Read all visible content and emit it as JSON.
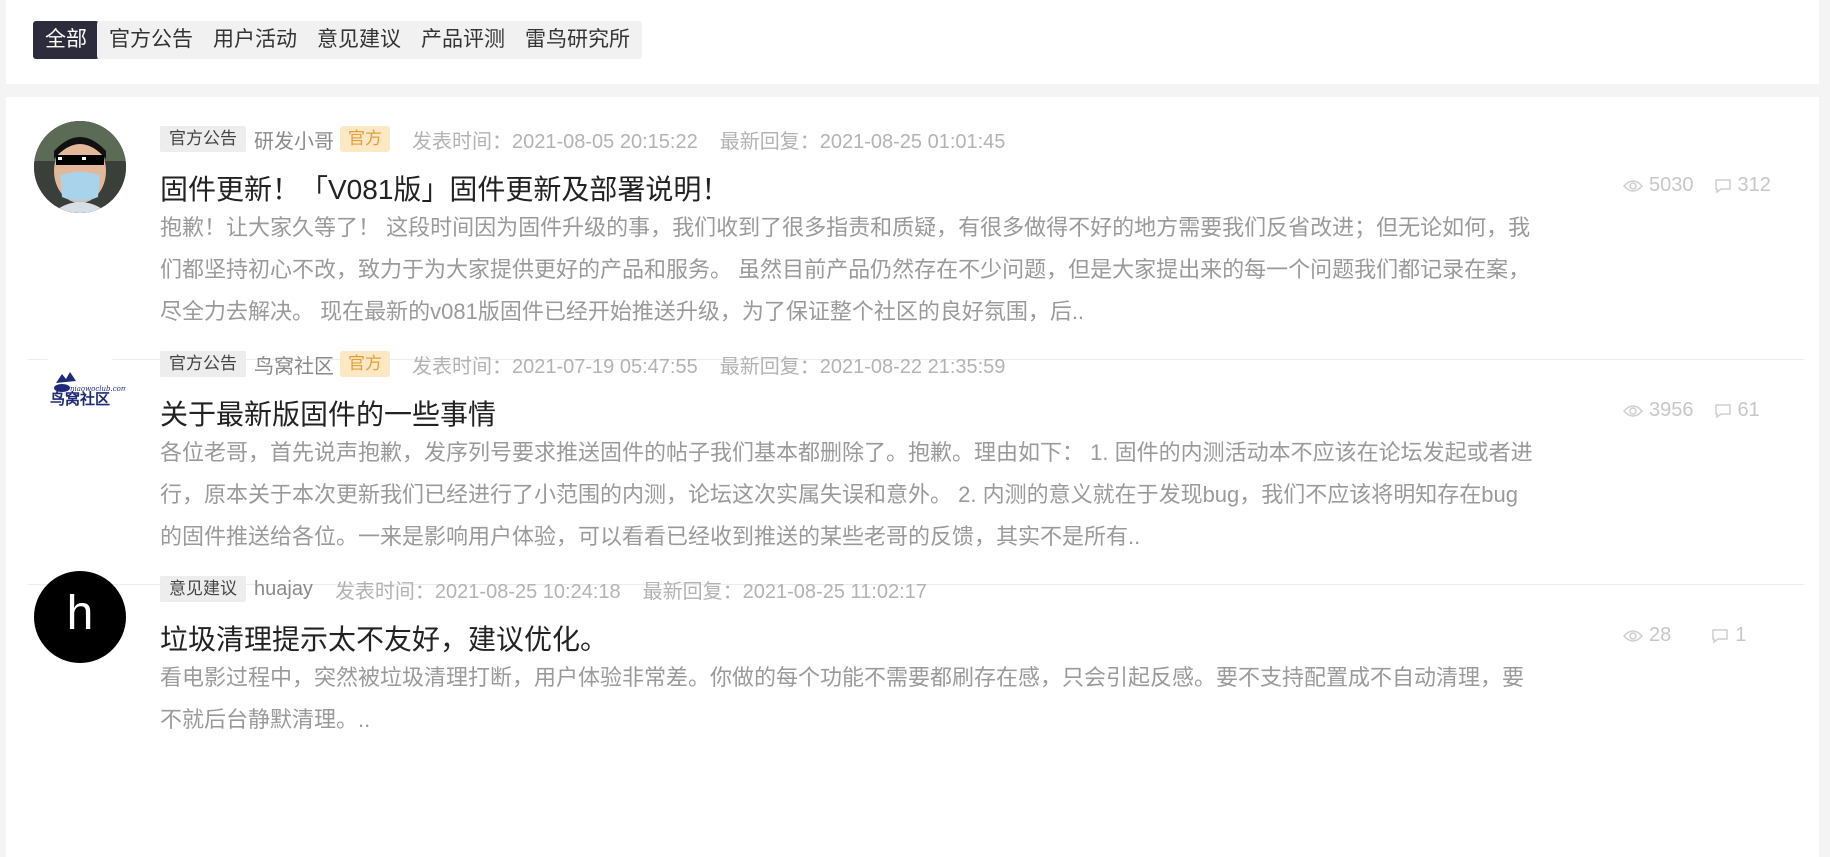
{
  "tabs": [
    {
      "label": "全部",
      "active": true
    },
    {
      "label": "官方公告",
      "active": false
    },
    {
      "label": "用户活动",
      "active": false
    },
    {
      "label": "意见建议",
      "active": false
    },
    {
      "label": "产品评测",
      "active": false
    },
    {
      "label": "雷鸟研究所",
      "active": false
    }
  ],
  "posts": [
    {
      "category": "官方公告",
      "author": "研发小哥",
      "badge": "官方",
      "publish_time": "发表时间：2021-08-05 20:15:22",
      "last_reply": "最新回复：2021-08-25 01:01:45",
      "title": "固件更新！「V081版」固件更新及部署说明！",
      "excerpt_lines": [
        "抱歉！让大家久等了！ 这段时间因为固件升级的事，我们收到了很多指责和质疑，有很多做得不好的地方需要我们反省改进；但无论如何，我",
        "们都坚持初心不改，致力于为大家提供更好的产品和服务。 虽然目前产品仍然存在不少问题，但是大家提出来的每一个问题我们都记录在案，",
        "尽全力去解决。 现在最新的v081版固件已经开始推送升级，为了保证整个社区的良好氛围，后.."
      ],
      "views": "5030",
      "comments": "312"
    },
    {
      "category": "官方公告",
      "author": "鸟窝社区",
      "badge": "官方",
      "publish_time": "发表时间：2021-07-19 05:47:55",
      "last_reply": "最新回复：2021-08-22 21:35:59",
      "title": "关于最新版固件的一些事情",
      "logo_text": "鸟窝社区",
      "logo_small": "niaowoclub.com",
      "excerpt_lines": [
        "各位老哥，首先说声抱歉，发序列号要求推送固件的帖子我们基本都删除了。抱歉。理由如下： 1. 固件的内测活动本不应该在论坛发起或者进",
        "行，原本关于本次更新我们已经进行了小范围的内测，论坛这次实属失误和意外。 2. 内测的意义就在于发现bug，我们不应该将明知存在bug",
        "的固件推送给各位。一来是影响用户体验，可以看看已经收到推送的某些老哥的反馈，其实不是所有.."
      ],
      "views": "3956",
      "comments": "61"
    },
    {
      "category": "意见建议",
      "author": "huajay",
      "publish_time": "发表时间：2021-08-25 10:24:18",
      "last_reply": "最新回复：2021-08-25 11:02:17",
      "title": "垃圾清理提示太不友好，建议优化。",
      "avatar_letter": "h",
      "excerpt_lines": [
        "看电影过程中，突然被垃圾清理打断，用户体验非常差。你做的每个功能不需要都刷存在感，只会引起反感。要不支持配置成不自动清理，要",
        "不就后台静默清理。.."
      ],
      "views": "28",
      "comments": "1"
    }
  ],
  "colors": {
    "active_tab_bg": "#2c2c3c",
    "official_badge_bg": "#fde8c6",
    "official_badge_text": "#e0a03c"
  },
  "icons": {
    "views": "eye-icon",
    "comments": "comment-icon"
  }
}
